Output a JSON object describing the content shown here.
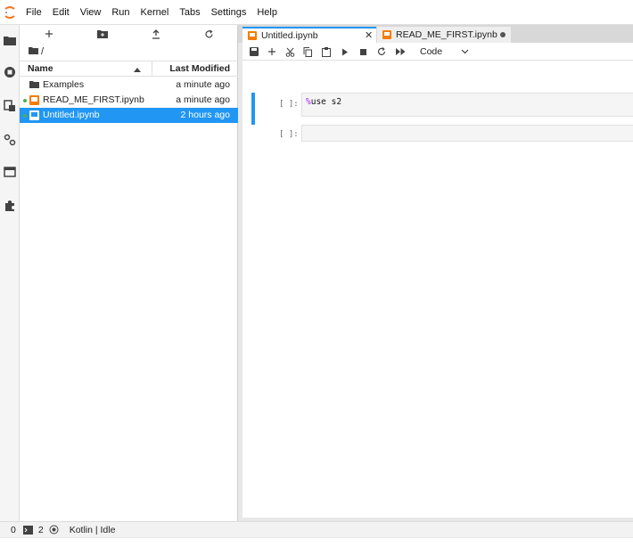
{
  "menu": {
    "items": [
      "File",
      "Edit",
      "View",
      "Run",
      "Kernel",
      "Tabs",
      "Settings",
      "Help"
    ]
  },
  "filebrowser": {
    "breadcrumb": "/",
    "header": {
      "name": "Name",
      "modified": "Last Modified"
    },
    "rows": [
      {
        "name": "Examples",
        "modified": "a minute ago",
        "type": "folder",
        "running": false,
        "selected": false
      },
      {
        "name": "READ_ME_FIRST.ipynb",
        "modified": "a minute ago",
        "type": "notebook",
        "running": true,
        "selected": false
      },
      {
        "name": "Untitled.ipynb",
        "modified": "2 hours ago",
        "type": "notebook",
        "running": true,
        "selected": true
      }
    ]
  },
  "tabs": [
    {
      "label": "Untitled.ipynb",
      "active": true
    },
    {
      "label": "READ_ME_FIRST.ipynb",
      "active": false
    }
  ],
  "notebook": {
    "cell_type": "Code",
    "cells": [
      {
        "prompt": "[ ]:",
        "magic": "%",
        "code": "use s2"
      },
      {
        "prompt": "[ ]:",
        "magic": "",
        "code": ""
      }
    ]
  },
  "status": {
    "count_a": "0",
    "count_b": "2",
    "kernel": "Kotlin | Idle"
  },
  "colors": {
    "accent": "#2196f3",
    "notebook_icon": "#f57c00",
    "running_dot": "#4caf50"
  }
}
